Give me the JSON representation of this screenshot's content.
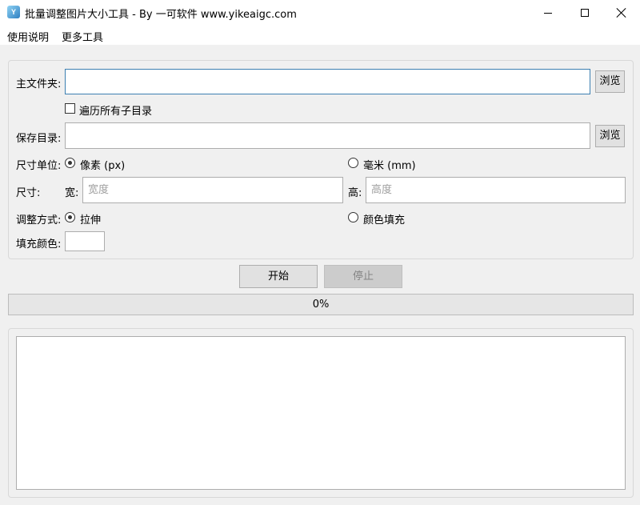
{
  "window": {
    "icon_text": "Y",
    "title": "批量调整图片大小工具 - By 一可软件 www.yikeaigc.com"
  },
  "menu": {
    "items": [
      "使用说明",
      "更多工具"
    ]
  },
  "form": {
    "main_folder_label": "主文件夹:",
    "main_folder_value": "",
    "browse_label": "浏览",
    "recurse_label": "遍历所有子目录",
    "recurse_checked": false,
    "save_dir_label": "保存目录:",
    "save_dir_value": "",
    "unit_label": "尺寸单位:",
    "unit_options": [
      "像素 (px)",
      "毫米 (mm)"
    ],
    "unit_selected": "像素 (px)",
    "size_label": "尺寸:",
    "width_label": "宽:",
    "width_placeholder": "宽度",
    "height_label": "高:",
    "height_placeholder": "高度",
    "mode_label": "调整方式:",
    "mode_options": [
      "拉伸",
      "颜色填充"
    ],
    "mode_selected": "拉伸",
    "fill_color_label": "填充颜色:",
    "fill_color": "#ffffff"
  },
  "actions": {
    "start_label": "开始",
    "stop_label": "停止",
    "stop_enabled": false
  },
  "progress": {
    "value": 0,
    "text": "0%"
  },
  "log": {
    "text": ""
  },
  "colors": {
    "focus_border": "#3c7fb1",
    "progress_fill": "#06b025"
  }
}
